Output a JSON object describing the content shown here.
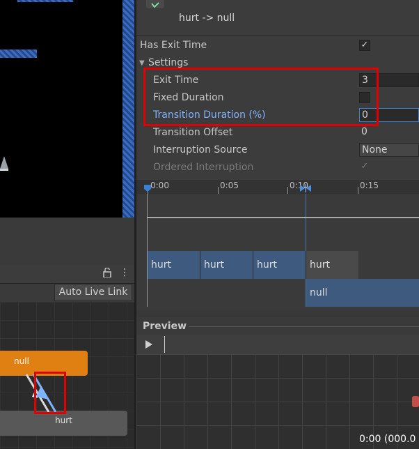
{
  "inspector": {
    "transition_title": "hurt -> null",
    "has_exit_time_label": "Has Exit Time",
    "has_exit_time_checked": "✓",
    "settings_label": "Settings",
    "exit_time_label": "Exit Time",
    "exit_time_value": "3",
    "fixed_duration_label": "Fixed Duration",
    "transition_duration_label": "Transition Duration (%)",
    "transition_duration_value": "0",
    "transition_offset_label": "Transition Offset",
    "transition_offset_value": "0",
    "interruption_source_label": "Interruption Source",
    "interruption_source_value": "None",
    "ordered_interruption_label": "Ordered Interruption",
    "ordered_interruption_checked": "✓"
  },
  "timeline": {
    "ticks": [
      "0:00",
      "0:05",
      "0:10",
      "0:15"
    ],
    "row1_clips": [
      "hurt",
      "hurt",
      "hurt",
      "hurt"
    ],
    "row2_clip": "null"
  },
  "animator": {
    "auto_live_link": "Auto Live Link",
    "state_null": "null",
    "state_hurt": "hurt"
  },
  "preview": {
    "title": "Preview",
    "time_readout": "0:00 (000.0"
  },
  "colors": {
    "highlight_red": "#e00000",
    "orange_state": "#e07f12",
    "clip_blue": "#3e5a7e",
    "link_blue": "#7fb2ff"
  }
}
